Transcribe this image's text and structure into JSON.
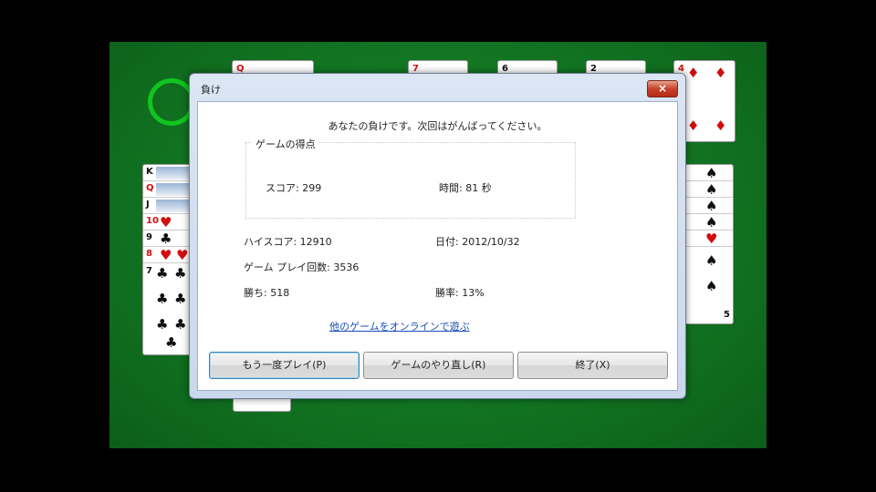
{
  "dialog": {
    "title": "負け",
    "close_symbol": "×",
    "message": "あなたの負けです。次回はがんばってください。",
    "group_title": "ゲームの得点",
    "score_label": "スコア: 299",
    "time_label": "時間:   81 秒",
    "high_score": "ハイスコア: 12910",
    "date": "日付: 2012/10/32",
    "games_played": "ゲーム プレイ回数: 3536",
    "wins": "勝ち: 518",
    "win_rate": "勝率: 13%",
    "online_link": "他のゲームをオンラインで遊ぶ"
  },
  "buttons": {
    "play_again": "もう一度プレイ(P)",
    "restart": "ゲームのやり直し(R)",
    "quit": "終了(X)"
  },
  "cards": {
    "top_left_rank": "Q",
    "top_rank_1": "7",
    "top_rank_2": "6",
    "top_rank_3": "2",
    "foundation_rank": "4",
    "foundation_suit": "♦",
    "left_ranks": [
      "K",
      "Q",
      "J",
      "10",
      "9",
      "8",
      "7"
    ],
    "right_rank": "5",
    "right_suit": "♠"
  },
  "colors": {
    "felt": "#127522",
    "ring": "#11c41f",
    "red_suit": "#d10e0e"
  }
}
